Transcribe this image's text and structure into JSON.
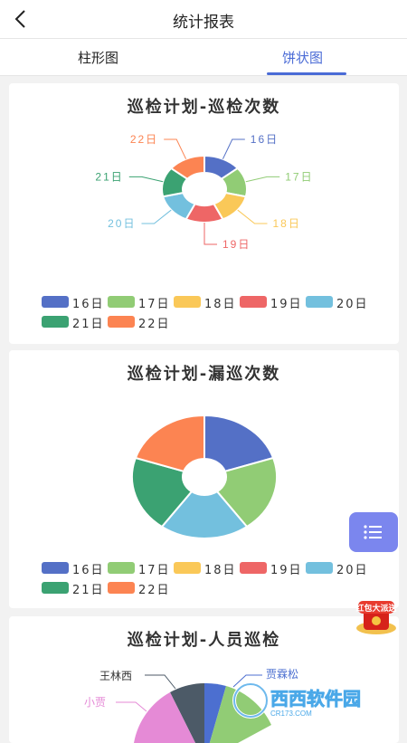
{
  "header": {
    "title": "统计报表"
  },
  "tabs": [
    {
      "label": "柱形图"
    },
    {
      "label": "饼状图"
    }
  ],
  "colors": {
    "accent": "#4a6bd6",
    "days": {
      "16日": "#5470c6",
      "17日": "#91cc75",
      "18日": "#fac858",
      "19日": "#ee6666",
      "20日": "#73c0de",
      "21日": "#3ba272",
      "22日": "#fc8452"
    }
  },
  "legend_items": [
    "16日",
    "17日",
    "18日",
    "19日",
    "20日",
    "21日",
    "22日"
  ],
  "chart_data": [
    {
      "type": "pie",
      "title": "巡检计划-巡检次数",
      "categories": [
        "16日",
        "17日",
        "18日",
        "19日",
        "20日",
        "21日",
        "22日"
      ],
      "values": [
        1,
        1,
        1,
        1,
        1,
        1,
        1
      ],
      "donut": true,
      "labels_outside": true
    },
    {
      "type": "pie",
      "title": "巡检计划-漏巡次数",
      "categories": [
        "16日",
        "17日",
        "20日",
        "21日",
        "22日"
      ],
      "values": [
        1,
        1,
        1,
        1,
        1
      ],
      "donut": true,
      "labels_outside": false
    },
    {
      "type": "pie",
      "title": "巡检计划-人员巡检",
      "categories": [
        "贾霖松",
        "王林西",
        "小贾"
      ],
      "values": null,
      "partially_visible": true
    }
  ],
  "floating": {
    "fab_icon": "list-icon",
    "promo_text": "红包大派送"
  },
  "watermark": {
    "text": "西西软件园",
    "sub": "CR173.COM"
  }
}
